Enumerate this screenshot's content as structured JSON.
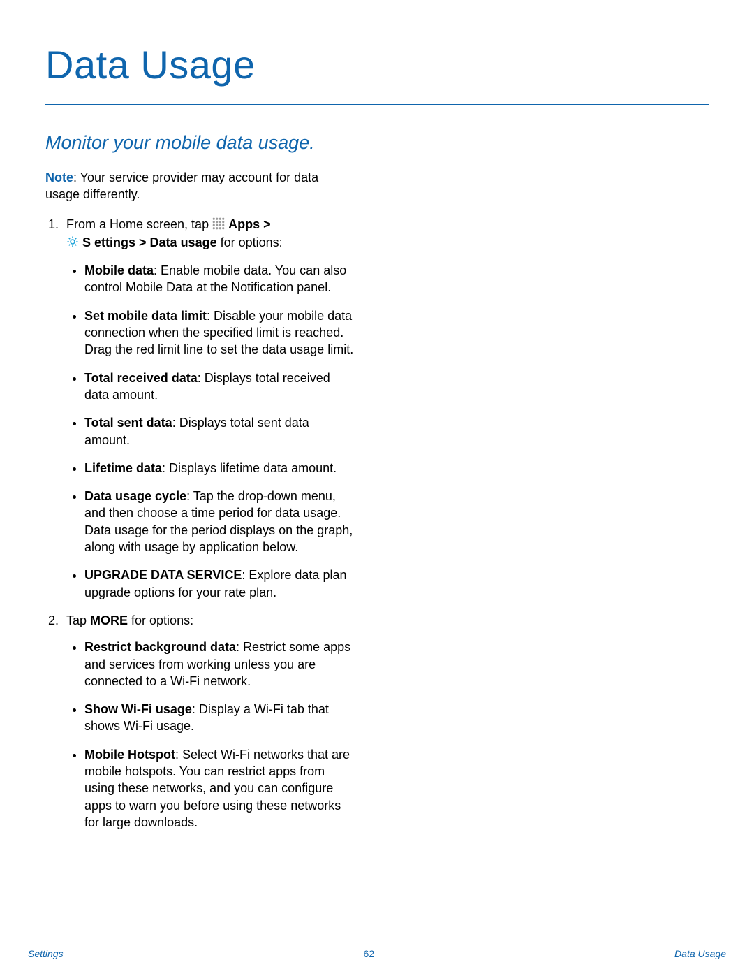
{
  "title": "Data Usage",
  "subtitle": "Monitor your mobile data usage.",
  "note": {
    "label": "Note",
    "text": ": Your service provider may account for data usage differently."
  },
  "step1": {
    "pre": "From a Home screen, tap ",
    "apps": "Apps",
    "gt1": " > ",
    "settings": "S ettings",
    "gt2": " > ",
    "datausage": "Data usage",
    "post": " for options:",
    "bullets": [
      {
        "head": "Mobile data",
        "body": ": Enable mobile data. You can also control Mobile Data at the Notification panel."
      },
      {
        "head": "Set mobile data limit",
        "body": ": Disable your mobile data connection when the specified limit is reached. Drag the red limit line to set the data usage limit."
      },
      {
        "head": "Total received data",
        "body": ": Displays total received data amount."
      },
      {
        "head": "Total sent data",
        "body": ": Displays total sent data amount."
      },
      {
        "head": "Lifetime data",
        "body": ": Displays lifetime data amount."
      },
      {
        "head": "Data usage cycle",
        "body": ": Tap the drop-down menu, and then choose a time period for data usage. Data usage for the period displays on the graph, along with usage by application below."
      },
      {
        "head": "UPGRADE DATA SERVICE",
        "body": ": Explore data plan upgrade options for your rate plan."
      }
    ]
  },
  "step2": {
    "pre": "Tap ",
    "more": "MORE",
    "post": " for options:",
    "bullets": [
      {
        "head": "Restrict background data",
        "body": ": Restrict some apps and services from working unless you are connected to a Wi-Fi network."
      },
      {
        "head": "Show Wi-Fi usage",
        "body": ": Display a Wi-Fi tab that shows Wi-Fi usage."
      },
      {
        "head": "Mobile Hotspot",
        "body": ": Select Wi-Fi networks that are mobile hotspots. You can restrict apps from using these networks, and you can configure apps to warn you before using these networks for large downloads."
      }
    ]
  },
  "footer": {
    "left": "Settings",
    "center": "62",
    "right": "Data Usage"
  }
}
